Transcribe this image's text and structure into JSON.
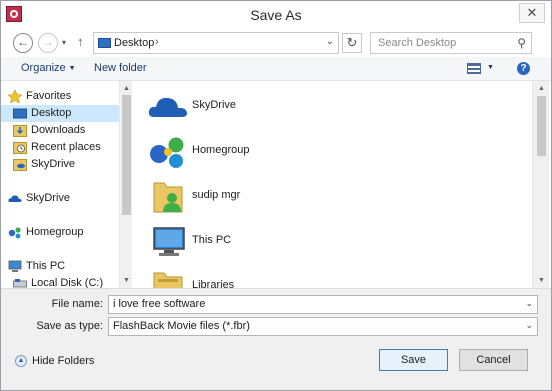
{
  "window": {
    "title": "Save As",
    "close_glyph": "✕"
  },
  "navigation": {
    "back_glyph": "←",
    "forward_glyph": "→",
    "dropdown_glyph": "▾",
    "up_glyph": "↑",
    "address": {
      "segment": "Desktop",
      "separator": "›",
      "chevron": "⌄"
    },
    "refresh_glyph": "↻",
    "search": {
      "placeholder": "Search Desktop",
      "icon_glyph": "⚲"
    }
  },
  "toolbar": {
    "organize_label": "Organize",
    "new_folder_label": "New folder",
    "help_glyph": "?"
  },
  "nav_pane": {
    "items": [
      {
        "label": "Favorites",
        "icon": "star-icon"
      },
      {
        "label": "Desktop",
        "icon": "desktop-icon",
        "selected": true
      },
      {
        "label": "Downloads",
        "icon": "downloads-folder-icon"
      },
      {
        "label": "Recent places",
        "icon": "recent-places-icon"
      },
      {
        "label": "SkyDrive",
        "icon": "skydrive-folder-icon"
      },
      {
        "label": "SkyDrive",
        "icon": "skydrive-cloud-icon"
      },
      {
        "label": "Homegroup",
        "icon": "homegroup-icon"
      },
      {
        "label": "This PC",
        "icon": "this-pc-icon"
      },
      {
        "label": "Local Disk (C:)",
        "icon": "local-disk-icon"
      }
    ]
  },
  "files": [
    {
      "label": "SkyDrive",
      "icon": "skydrive-cloud-icon"
    },
    {
      "label": "Homegroup",
      "icon": "homegroup-icon"
    },
    {
      "label": "sudip mgr",
      "icon": "user-folder-icon"
    },
    {
      "label": "This PC",
      "icon": "this-pc-icon"
    },
    {
      "label": "Libraries",
      "icon": "libraries-folder-icon"
    }
  ],
  "form": {
    "file_name_label": "File name:",
    "file_name_value": "i love free software",
    "save_as_type_label": "Save as type:",
    "save_as_type_value": "FlashBack Movie files (*.fbr)",
    "chevron": "⌄"
  },
  "footer": {
    "hide_folders_label": "Hide Folders",
    "hide_folders_glyph": "▲",
    "save_label": "Save",
    "cancel_label": "Cancel"
  },
  "scroll": {
    "up_glyph": "▲",
    "down_glyph": "▼"
  },
  "colors": {
    "selection": "#cce8ff",
    "accent_blue": "#2a66c4",
    "default_button_border": "#3c7fb1"
  }
}
